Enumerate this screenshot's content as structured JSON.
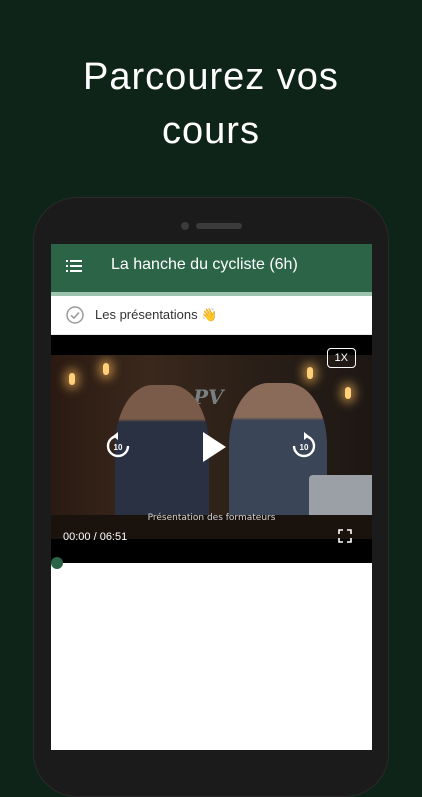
{
  "headline": "Parcourez vos\ncours",
  "app": {
    "title": "La hanche du cycliste (6h)"
  },
  "lesson": {
    "label": "Les présentations",
    "emoji": "👋"
  },
  "player": {
    "speed_label": "1X",
    "skip_seconds": "10",
    "caption": "Présentation des formateurs",
    "time_readout": "00:00 / 06:51",
    "progress": 0.0
  },
  "colors": {
    "background": "#0f2419",
    "appbar": "#2b6447",
    "accent": "#2b6447"
  }
}
